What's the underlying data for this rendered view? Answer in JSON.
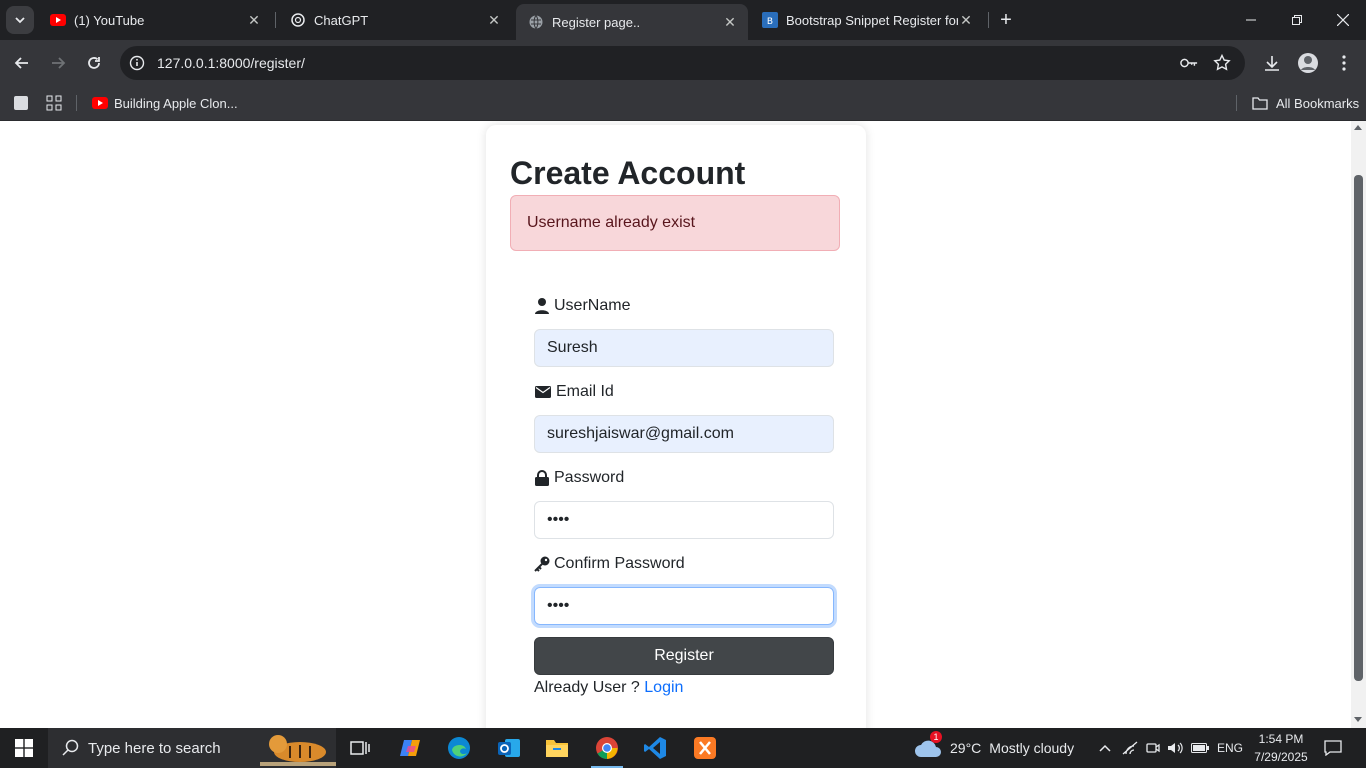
{
  "browser": {
    "tabs": [
      {
        "title": "(1) YouTube",
        "icon": "youtube-icon"
      },
      {
        "title": "ChatGPT",
        "icon": "chatgpt-icon"
      },
      {
        "title": "Register page..",
        "icon": "globe-icon"
      },
      {
        "title": "Bootstrap Snippet Register form",
        "icon": "bootstrap-icon"
      }
    ],
    "url": "127.0.0.1:8000/register/",
    "bookmarks": [
      {
        "title": "Building Apple Clon..."
      }
    ],
    "all_bookmarks_label": "All Bookmarks"
  },
  "page": {
    "heading": "Create Account",
    "alert": "Username already exist",
    "fields": {
      "username": {
        "label": "UserName",
        "value": "Suresh"
      },
      "email": {
        "label": "Email Id",
        "value": "sureshjaiswar@gmail.com"
      },
      "password": {
        "label": "Password",
        "value": "••••"
      },
      "confirm": {
        "label": "Confirm Password",
        "value": "••••"
      }
    },
    "register_label": "Register",
    "already_text": "Already User ?",
    "login_label": "Login"
  },
  "taskbar": {
    "search_placeholder": "Type here to search",
    "weather": {
      "temp": "29°C",
      "condition": "Mostly cloudy",
      "badge": "1"
    },
    "lang": "ENG",
    "time": "1:54 PM",
    "date": "7/29/2025"
  },
  "colors": {
    "alert_bg": "#f8d7da",
    "alert_text": "#58151c",
    "link": "#0d6efd",
    "button": "#424649"
  }
}
